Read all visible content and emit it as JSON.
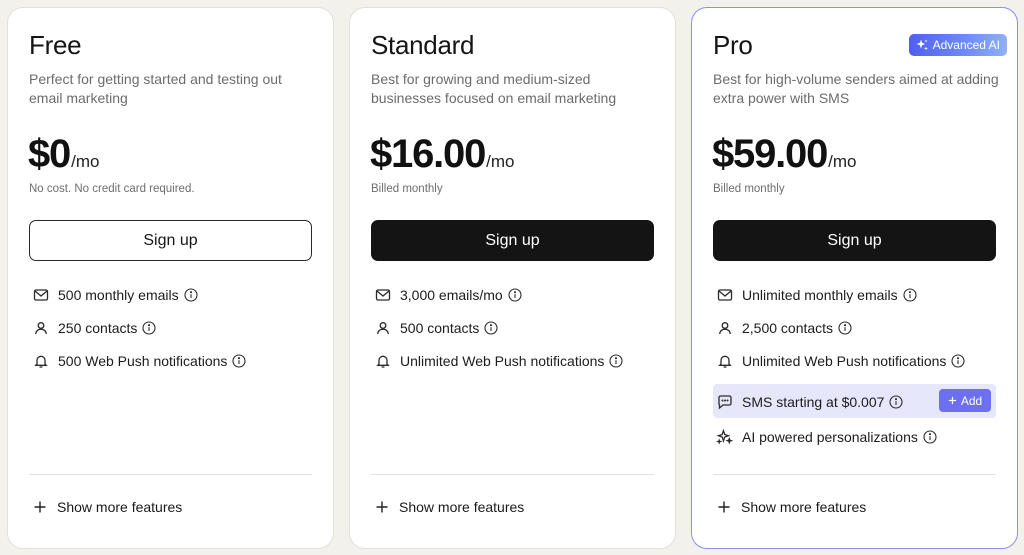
{
  "plans": [
    {
      "name": "Free",
      "description": "Perfect for getting started and testing out email marketing",
      "price": "$0",
      "period": "/mo",
      "note": "No cost. No credit card required.",
      "cta": "Sign up",
      "features": [
        {
          "icon": "mail-icon",
          "label": "500 monthly emails"
        },
        {
          "icon": "user-icon",
          "label": "250 contacts"
        },
        {
          "icon": "bell-icon",
          "label": "500 Web Push notifications"
        }
      ],
      "more": "Show more features"
    },
    {
      "name": "Standard",
      "description": "Best for growing and medium-sized businesses focused on email marketing",
      "price": "$16.00",
      "period": "/mo",
      "note": "Billed monthly",
      "cta": "Sign up",
      "features": [
        {
          "icon": "mail-icon",
          "label": "3,000 emails/mo"
        },
        {
          "icon": "user-icon",
          "label": "500 contacts"
        },
        {
          "icon": "bell-icon",
          "label": "Unlimited Web Push notifications"
        }
      ],
      "more": "Show more features"
    },
    {
      "name": "Pro",
      "badge": "Advanced AI",
      "description": "Best for high-volume senders aimed at adding extra power with SMS",
      "price": "$59.00",
      "period": "/mo",
      "note": "Billed monthly",
      "cta": "Sign up",
      "features": [
        {
          "icon": "mail-icon",
          "label": "Unlimited monthly emails"
        },
        {
          "icon": "user-icon",
          "label": "2,500 contacts"
        },
        {
          "icon": "bell-icon",
          "label": "Unlimited Web Push notifications"
        }
      ],
      "sms": {
        "icon": "chat-icon",
        "label": "SMS starting at $0.007",
        "add_label": "Add"
      },
      "ai": {
        "icon": "sparkle-icon",
        "label": "AI powered personalizations"
      },
      "more": "Show more features"
    }
  ],
  "colors": {
    "accent": "#6c6ff0",
    "pro_border": "#8d8ff0",
    "sms_highlight": "#e7e7fb",
    "button_dark": "#141414",
    "page_bg": "#f3f1ec"
  }
}
